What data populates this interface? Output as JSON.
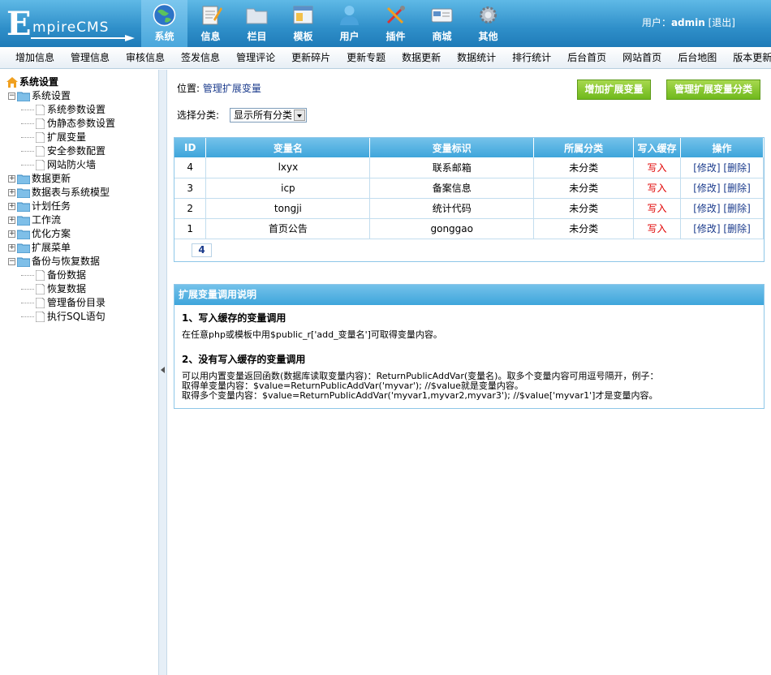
{
  "logo": {
    "first": "E",
    "rest": "mpireCMS"
  },
  "topnav": [
    {
      "label": "系统",
      "icon": "globe-icon",
      "active": true
    },
    {
      "label": "信息",
      "icon": "notepad-icon"
    },
    {
      "label": "栏目",
      "icon": "folder-icon"
    },
    {
      "label": "模板",
      "icon": "window-icon"
    },
    {
      "label": "用户",
      "icon": "user-icon"
    },
    {
      "label": "插件",
      "icon": "tools-icon"
    },
    {
      "label": "商城",
      "icon": "card-icon"
    },
    {
      "label": "其他",
      "icon": "gear-icon"
    }
  ],
  "user": {
    "prefix": "用户：",
    "name": "admin",
    "logout": "[退出]"
  },
  "subnav": [
    "增加信息",
    "管理信息",
    "审核信息",
    "签发信息",
    "管理评论",
    "更新碎片",
    "更新专题",
    "数据更新",
    "数据统计",
    "排行统计",
    "后台首页",
    "网站首页",
    "后台地图",
    "版本更新"
  ],
  "sidebar": {
    "root": "系统设置",
    "nodes": [
      {
        "label": "系统设置",
        "open": true,
        "children": [
          "系统参数设置",
          "伪静态参数设置",
          "扩展变量",
          "安全参数配置",
          "网站防火墙"
        ]
      },
      {
        "label": "数据更新"
      },
      {
        "label": "数据表与系统模型"
      },
      {
        "label": "计划任务"
      },
      {
        "label": "工作流"
      },
      {
        "label": "优化方案"
      },
      {
        "label": "扩展菜单"
      },
      {
        "label": "备份与恢复数据",
        "open": true,
        "children": [
          "备份数据",
          "恢复数据",
          "管理备份目录",
          "执行SQL语句"
        ]
      }
    ]
  },
  "main": {
    "location_prefix": "位置:",
    "location_link": "管理扩展变量",
    "btn_add": "增加扩展变量",
    "btn_manage": "管理扩展变量分类",
    "filter_label": "选择分类:",
    "filter_value": "显示所有分类",
    "table": {
      "headers": [
        "ID",
        "变量名",
        "变量标识",
        "所属分类",
        "写入缓存",
        "操作"
      ],
      "rows": [
        {
          "id": "4",
          "name": "lxyx",
          "key": "联系邮箱",
          "cat": "未分类",
          "cache": "写入",
          "edit": "[修改]",
          "del": "[删除]"
        },
        {
          "id": "3",
          "name": "icp",
          "key": "备案信息",
          "cat": "未分类",
          "cache": "写入",
          "edit": "[修改]",
          "del": "[删除]"
        },
        {
          "id": "2",
          "name": "tongji",
          "key": "统计代码",
          "cat": "未分类",
          "cache": "写入",
          "edit": "[修改]",
          "del": "[删除]"
        },
        {
          "id": "1",
          "name": "首页公告",
          "key": "gonggao",
          "cat": "未分类",
          "cache": "写入",
          "edit": "[修改]",
          "del": "[删除]"
        }
      ],
      "page": "4"
    },
    "help": {
      "title": "扩展变量调用说明",
      "h1": "1、写入缓存的变量调用",
      "p1": "在任意php或模板中用$public_r['add_变量名']可取得变量内容。",
      "h2": "2、没有写入缓存的变量调用",
      "p2_l1": "可以用内置变量返回函数(数据库读取变量内容)：ReturnPublicAddVar(变量名)。取多个变量内容可用逗号隔开，例子：",
      "p2_l2": "取得单变量内容：$value=ReturnPublicAddVar('myvar'); //$value就是变量内容。",
      "p2_l3": "取得多个变量内容：$value=ReturnPublicAddVar('myvar1,myvar2,myvar3'); //$value['myvar1']才是变量内容。"
    }
  }
}
